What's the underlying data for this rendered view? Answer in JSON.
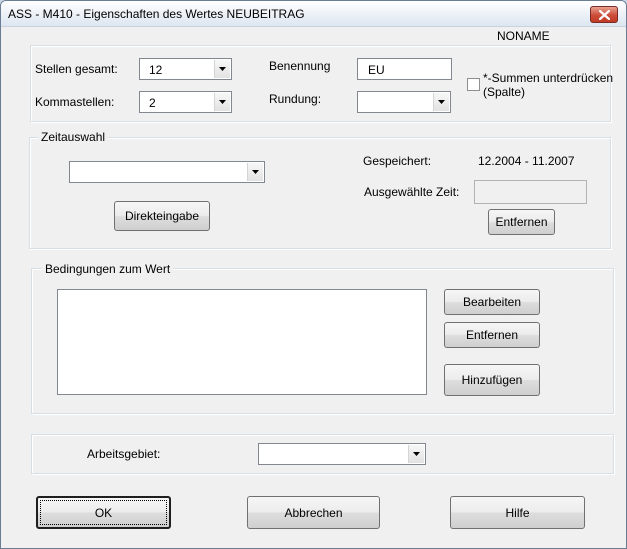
{
  "window": {
    "title": "ASS - M410 - Eigenschaften des Wertes NEUBEITRAG"
  },
  "header": {
    "noname": "NONAME"
  },
  "top_group": {
    "stellen_gesamt_label": "Stellen gesamt:",
    "stellen_gesamt_value": "12",
    "kommastellen_label": "Kommastellen:",
    "kommastellen_value": "2",
    "benennung_label": "Benennung",
    "benennung_value": "EU",
    "rundung_label": "Rundung:",
    "rundung_value": "",
    "summen_line1": "*-Summen unterdrücken",
    "summen_line2": "(Spalte)"
  },
  "zeitauswahl": {
    "title": "Zeitauswahl",
    "combo_value": "",
    "direkteingabe_label": "Direkteingabe",
    "gespeichert_label": "Gespeichert:",
    "gespeichert_value": "12.2004 - 11.2007",
    "ausgewaehlte_zeit_label": "Ausgewählte Zeit:",
    "ausgewaehlte_zeit_value": "",
    "entfernen_label": "Entfernen"
  },
  "bedingungen": {
    "title": "Bedingungen zum Wert",
    "items": [],
    "bearbeiten_label": "Bearbeiten",
    "entfernen_label": "Entfernen",
    "hinzufuegen_label": "Hinzufügen"
  },
  "arbeitsgebiet": {
    "label": "Arbeitsgebiet:",
    "value": ""
  },
  "footer": {
    "ok_label": "OK",
    "abbrechen_label": "Abbrechen",
    "hilfe_label": "Hilfe"
  },
  "colors": {
    "dialog_background": "#f0f0f0",
    "close_button": "#c94a35"
  },
  "icons": [
    "close-icon",
    "dropdown-arrow-icon",
    "checkbox-icon"
  ]
}
